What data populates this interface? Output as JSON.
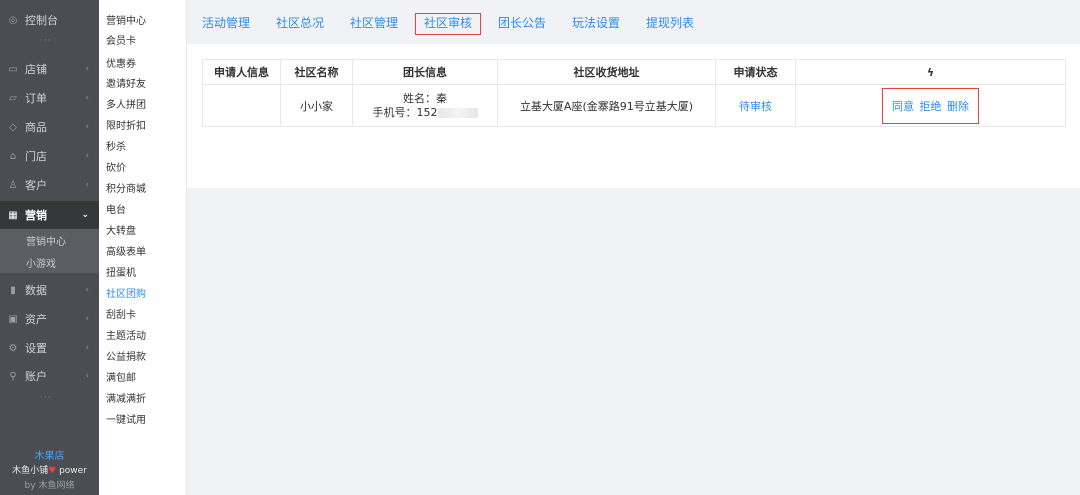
{
  "sidebar": {
    "items": [
      {
        "icon": "dashboard-icon",
        "glyph": "◎",
        "label": "控制台"
      },
      {
        "icon": "store-icon",
        "glyph": "▭",
        "label": "店铺"
      },
      {
        "icon": "order-icon",
        "glyph": "▱",
        "label": "订单"
      },
      {
        "icon": "goods-icon",
        "glyph": "◇",
        "label": "商品"
      },
      {
        "icon": "shop-icon",
        "glyph": "⌂",
        "label": "门店"
      },
      {
        "icon": "customer-icon",
        "glyph": "♙",
        "label": "客户"
      },
      {
        "icon": "marketing-icon",
        "glyph": "▦",
        "label": "营销"
      },
      {
        "icon": "data-icon",
        "glyph": "▮",
        "label": "数据"
      },
      {
        "icon": "assets-icon",
        "glyph": "▣",
        "label": "资产"
      },
      {
        "icon": "settings-icon",
        "glyph": "⚙",
        "label": "设置"
      },
      {
        "icon": "account-icon",
        "glyph": "⚲",
        "label": "账户"
      }
    ],
    "marketing_sub": [
      "营销中心",
      "小游戏"
    ],
    "dots": "···",
    "brand_name": "木果店",
    "brand_power_prefix": "木鱼小铺",
    "brand_heart": "♥",
    "brand_power_suffix": "power",
    "brand_by": "by 木鱼网络"
  },
  "submenu": {
    "items": [
      "营销中心",
      "会员卡",
      "优惠券",
      "邀请好友",
      "多人拼团",
      "限时折扣",
      "秒杀",
      "砍价",
      "积分商城",
      "电台",
      "大转盘",
      "高级表单",
      "扭蛋机",
      "社区团购",
      "刮刮卡",
      "主题活动",
      "公益捐款",
      "满包邮",
      "满减满折",
      "一键试用"
    ],
    "current_index": 13
  },
  "tabs": [
    "活动管理",
    "社区总况",
    "社区管理",
    "社区审核",
    "团长公告",
    "玩法设置",
    "提现列表"
  ],
  "selected_tab": 3,
  "table": {
    "headers": [
      "申请人信息",
      "社区名称",
      "团长信息",
      "社区收货地址",
      "申请状态",
      "ϟ"
    ],
    "row": {
      "applicant": "",
      "community": "小小家",
      "leader_name": "姓名：秦",
      "leader_phone": "手机号：152",
      "address": "立基大厦A座(金寨路91号立基大厦)",
      "status": "待审核",
      "actions": [
        "同意",
        "拒绝",
        "删除"
      ]
    }
  }
}
